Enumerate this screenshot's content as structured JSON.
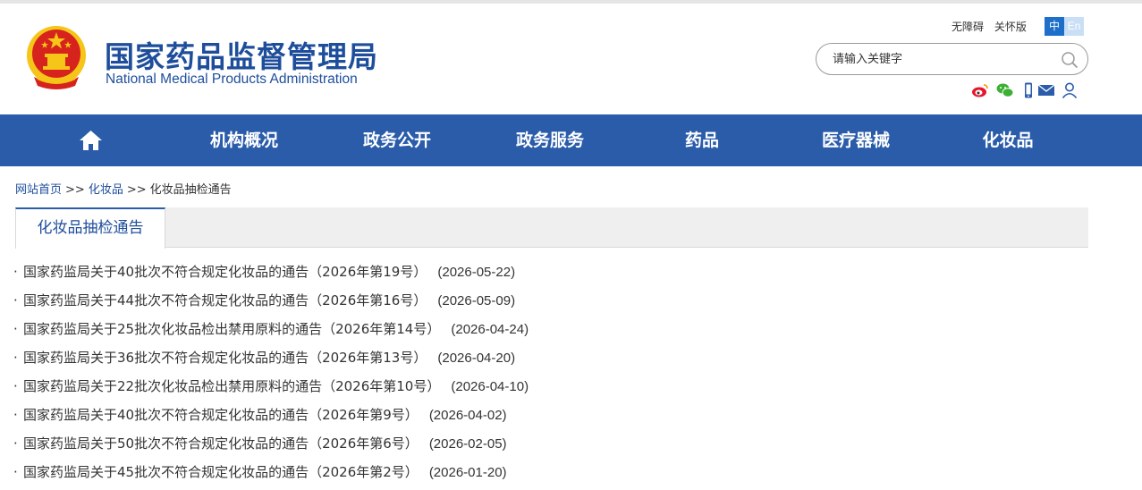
{
  "header": {
    "title": "国家药品监督管理局",
    "subtitle": "National Medical Products Administration",
    "links": [
      "无障碍",
      "关怀版"
    ],
    "lang_zh": "中",
    "lang_en": "En",
    "search_placeholder": "请输入关键字",
    "social_icons": [
      "weibo-icon",
      "wechat-icon",
      "mobile-icon",
      "mail-icon",
      "user-icon"
    ]
  },
  "nav": {
    "items": [
      "机构概况",
      "政务公开",
      "政务服务",
      "药品",
      "医疗器械",
      "化妆品"
    ]
  },
  "breadcrumb": {
    "home": "网站首页",
    "sep": ">>",
    "level1": "化妆品",
    "current": "化妆品抽检通告"
  },
  "tab": {
    "label": "化妆品抽检通告"
  },
  "list": [
    {
      "title": "国家药监局关于40批次不符合规定化妆品的通告（2026年第19号）",
      "date": "(2026-05-22)"
    },
    {
      "title": "国家药监局关于44批次不符合规定化妆品的通告（2026年第16号）",
      "date": "(2026-05-09)"
    },
    {
      "title": "国家药监局关于25批次化妆品检出禁用原料的通告（2026年第14号）",
      "date": "(2026-04-24)"
    },
    {
      "title": "国家药监局关于36批次不符合规定化妆品的通告（2026年第13号）",
      "date": "(2026-04-20)"
    },
    {
      "title": "国家药监局关于22批次化妆品检出禁用原料的通告（2026年第10号）",
      "date": "(2026-04-10)"
    },
    {
      "title": "国家药监局关于40批次不符合规定化妆品的通告（2026年第9号）",
      "date": "(2026-04-02)"
    },
    {
      "title": "国家药监局关于50批次不符合规定化妆品的通告（2026年第6号）",
      "date": "(2026-02-05)"
    },
    {
      "title": "国家药监局关于45批次不符合规定化妆品的通告（2026年第2号）",
      "date": "(2026-01-20)"
    }
  ],
  "colors": {
    "brand_blue": "#1e4e9b",
    "nav_blue": "#2a5caa",
    "emblem_red": "#d7231d",
    "emblem_gold": "#f5c518"
  }
}
